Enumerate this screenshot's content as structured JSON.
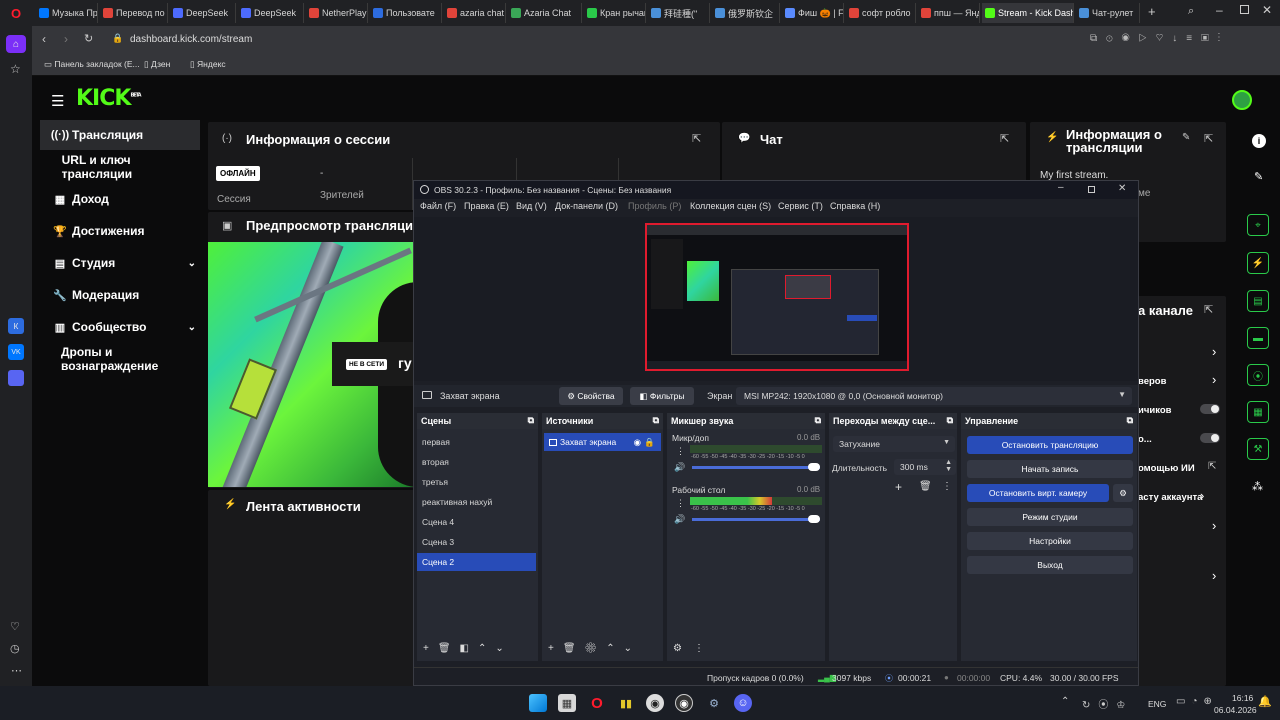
{
  "browser": {
    "tabs": [
      {
        "label": "Музыка Пр",
        "icon": "vk-icon",
        "color": "#0077ff"
      },
      {
        "label": "Перевод по",
        "icon": "yandex-icon",
        "color": "#e0443a"
      },
      {
        "label": "DeepSeek",
        "icon": "deepseek-icon",
        "color": "#4d6bfe"
      },
      {
        "label": "DeepSeek",
        "icon": "deepseek-icon",
        "color": "#4d6bfe"
      },
      {
        "label": "NetherPlay",
        "icon": "netherplay-icon",
        "color": "#e0443a"
      },
      {
        "label": "Пользовате",
        "icon": "profile-icon",
        "color": "#2d6cdf"
      },
      {
        "label": "azaria chat",
        "icon": "azaria-icon",
        "color": "#e0443a"
      },
      {
        "label": "Azaria Chat",
        "icon": "chat-icon",
        "color": "#3aa757"
      },
      {
        "label": "Кран рычаг",
        "icon": "crane-icon",
        "color": "#2ac94a"
      },
      {
        "label": "拜硅種(\"",
        "icon": "page-icon",
        "color": "#4a90d9"
      },
      {
        "label": "俄罗斯钦企",
        "icon": "page-icon",
        "color": "#4a90d9"
      },
      {
        "label": "Фиш 🎃 | F",
        "icon": "page-icon",
        "color": "#5a8bff"
      },
      {
        "label": "софт робло",
        "icon": "yandex-icon",
        "color": "#e0443a"
      },
      {
        "label": "ппш — Янд",
        "icon": "yandex-icon",
        "color": "#e0443a"
      },
      {
        "label": "Stream - Kick Dashb",
        "icon": "kick-icon",
        "color": "#53fc18"
      },
      {
        "label": "Чат-рулет",
        "icon": "page-icon",
        "color": "#4a90d9"
      }
    ],
    "new_tab": "+",
    "url": "dashboard.kick.com/stream",
    "bookmarks": [
      "Панель закладок (Е...",
      "Дзен",
      "Яндекс"
    ]
  },
  "kick": {
    "logo": "KICK",
    "logo_badge": "BETA",
    "nav": [
      {
        "label": "Трансляция",
        "icon": "broadcast-icon",
        "glyph": "((·))"
      },
      {
        "label": "URL и ключ трансляции",
        "icon": "",
        "glyph": ""
      },
      {
        "label": "Доход",
        "icon": "money-icon",
        "glyph": "▦"
      },
      {
        "label": "Достижения",
        "icon": "trophy-icon",
        "glyph": "🏆"
      },
      {
        "label": "Студия",
        "icon": "studio-icon",
        "glyph": "▤"
      },
      {
        "label": "Модерация",
        "icon": "wrench-icon",
        "glyph": "🔧"
      },
      {
        "label": "Сообщество",
        "icon": "community-icon",
        "glyph": "▥"
      },
      {
        "label": "Дропы и вознаграждение",
        "icon": "",
        "glyph": ""
      }
    ],
    "session": {
      "title": "Информация о сессии",
      "status_badge": "ОФЛАЙН",
      "session_label": "Сессия",
      "viewers_label": "Зрителей",
      "dash": "-"
    },
    "preview": {
      "title": "Предпросмотр трансляции",
      "live_badge": "НЕ В СЕТИ",
      "overlay_text": "гу"
    },
    "activity": {
      "title": "Лента активности"
    },
    "chat": {
      "title": "Чат"
    },
    "stream_info": {
      "title": "Информация о трансляции",
      "stream_title": "My first stream.",
      "cut": "ме"
    },
    "channel": {
      "title": "а канале",
      "rows": [
        "веров",
        "ичиков",
        "о...",
        "омощью ИИ",
        "асту аккаунта"
      ]
    }
  },
  "obs": {
    "title": "OBS 30.2.3 - Профиль: Без названия - Сцены: Без названия",
    "menu": [
      "Файл (F)",
      "Правка (E)",
      "Вид (V)",
      "Док-панели (D)",
      "Профиль (P)",
      "Коллекция сцен (S)",
      "Сервис (T)",
      "Справка (H)"
    ],
    "source_bar": {
      "source_name": "Захват экрана",
      "properties": "Свойства",
      "filters": "Фильтры",
      "display_label": "Экран",
      "display_value": "MSI MP242: 1920x1080 @ 0,0 (Основной монитор)"
    },
    "scenes": {
      "title": "Сцены",
      "items": [
        "первая",
        "вторая",
        "третья",
        "реактивная нахуй",
        "Сцена 4",
        "Сцена 3",
        "Сцена 2"
      ],
      "selected": 6
    },
    "sources": {
      "title": "Источники",
      "items": [
        "Захват экрана"
      ]
    },
    "mixer": {
      "title": "Микшер звука",
      "channels": [
        {
          "name": "Микр/доп",
          "db": "0.0 dB",
          "level": 0.0
        },
        {
          "name": "Рабочий стол",
          "db": "0.0 dB",
          "level": 0.62
        }
      ],
      "scale": "-60 -55 -50 -45 -40 -35 -30 -25 -20 -15 -10 -5 0"
    },
    "transitions": {
      "title": "Переходы между сце...",
      "type": "Затухание",
      "duration_label": "Длительность",
      "duration": "300 ms"
    },
    "controls": {
      "title": "Управление",
      "stop_stream": "Остановить трансляцию",
      "start_recording": "Начать запись",
      "stop_vcam": "Остановить вирт. камеру",
      "studio_mode": "Режим студии",
      "settings": "Настройки",
      "exit": "Выход"
    },
    "status": {
      "dropped": "Пропуск кадров 0 (0.0%)",
      "bitrate": "3097 kbps",
      "stream_time": "00:00:21",
      "rec_time": "00:00:00",
      "cpu": "CPU: 4.4%",
      "fps": "30.00 / 30.00 FPS"
    }
  },
  "taskbar": {
    "lang": "ENG",
    "time": "16:16",
    "date": "06.04.2026"
  },
  "colors": {
    "kick_green": "#53fc18",
    "obs_blue": "#284cb8",
    "obs_bg": "#1d1f26"
  }
}
